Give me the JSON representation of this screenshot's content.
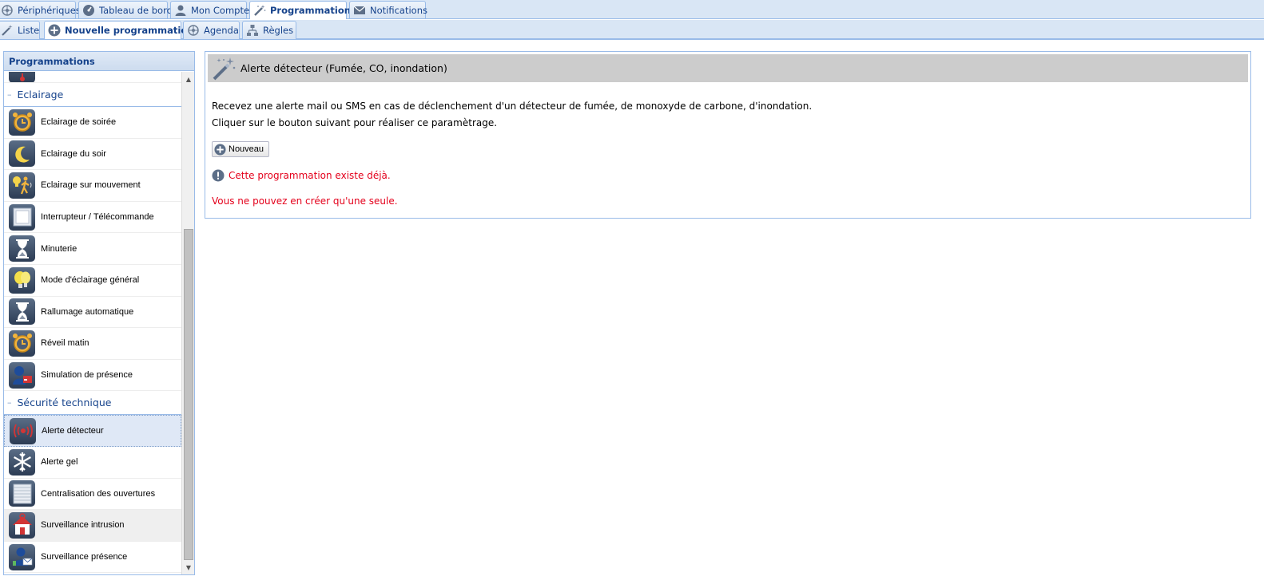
{
  "top_tabs": [
    {
      "label": "Périphériques",
      "icon": "network-icon"
    },
    {
      "label": "Tableau de bord",
      "icon": "dashboard-icon"
    },
    {
      "label": "Mon Compte",
      "icon": "user-icon"
    },
    {
      "label": "Programmation",
      "icon": "magic-wand-icon",
      "active": true
    },
    {
      "label": "Notifications",
      "icon": "envelope-icon"
    }
  ],
  "sub_tabs": [
    {
      "label": "Liste",
      "icon": "magic-wand-icon"
    },
    {
      "label": "Nouvelle programmation",
      "icon": "plus-circle-icon",
      "active": true
    },
    {
      "label": "Agenda",
      "icon": "network-icon"
    },
    {
      "label": "Règles",
      "icon": "tree-icon"
    }
  ],
  "left_panel": {
    "title": "Programmations",
    "groups": [
      {
        "label": "Eclairage",
        "items": [
          {
            "label": "Eclairage de soirée",
            "icon": "alarm-clock-icon"
          },
          {
            "label": "Eclairage du soir",
            "icon": "moon-icon"
          },
          {
            "label": "Eclairage sur mouvement",
            "icon": "motion-icon"
          },
          {
            "label": "Interrupteur / Télécommande",
            "icon": "switch-icon"
          },
          {
            "label": "Minuterie",
            "icon": "hourglass-icon"
          },
          {
            "label": "Mode d'éclairage général",
            "icon": "bulbs-icon"
          },
          {
            "label": "Rallumage automatique",
            "icon": "hourglass-icon"
          },
          {
            "label": "Réveil matin",
            "icon": "alarm-clock-icon"
          },
          {
            "label": "Simulation de présence",
            "icon": "presence-icon"
          }
        ]
      },
      {
        "label": "Sécurité technique",
        "items": [
          {
            "label": "Alerte détecteur",
            "icon": "detector-icon",
            "selected": true
          },
          {
            "label": "Alerte gel",
            "icon": "snowflake-icon"
          },
          {
            "label": "Centralisation des ouvertures",
            "icon": "shutter-icon"
          },
          {
            "label": "Surveillance intrusion",
            "icon": "house-alarm-icon",
            "hover": true
          },
          {
            "label": "Surveillance présence",
            "icon": "person-mail-icon"
          }
        ]
      }
    ]
  },
  "main": {
    "title": "Alerte détecteur (Fumée, CO, inondation)",
    "description_line1": "Recevez une alerte mail ou SMS en cas de déclenchement d'un détecteur de fumée, de monoxyde de carbone, d'inondation.",
    "description_line2": "Cliquer sur le bouton suivant pour réaliser ce paramètrage.",
    "new_button": "Nouveau",
    "warning_1": "Cette programmation existe déjà.",
    "warning_2": "Vous ne pouvez en créer qu'une seule."
  },
  "colors": {
    "tab_text": "#15428b",
    "border": "#99bbe8",
    "warning": "#e4001b",
    "header_gray": "#cccccc"
  }
}
